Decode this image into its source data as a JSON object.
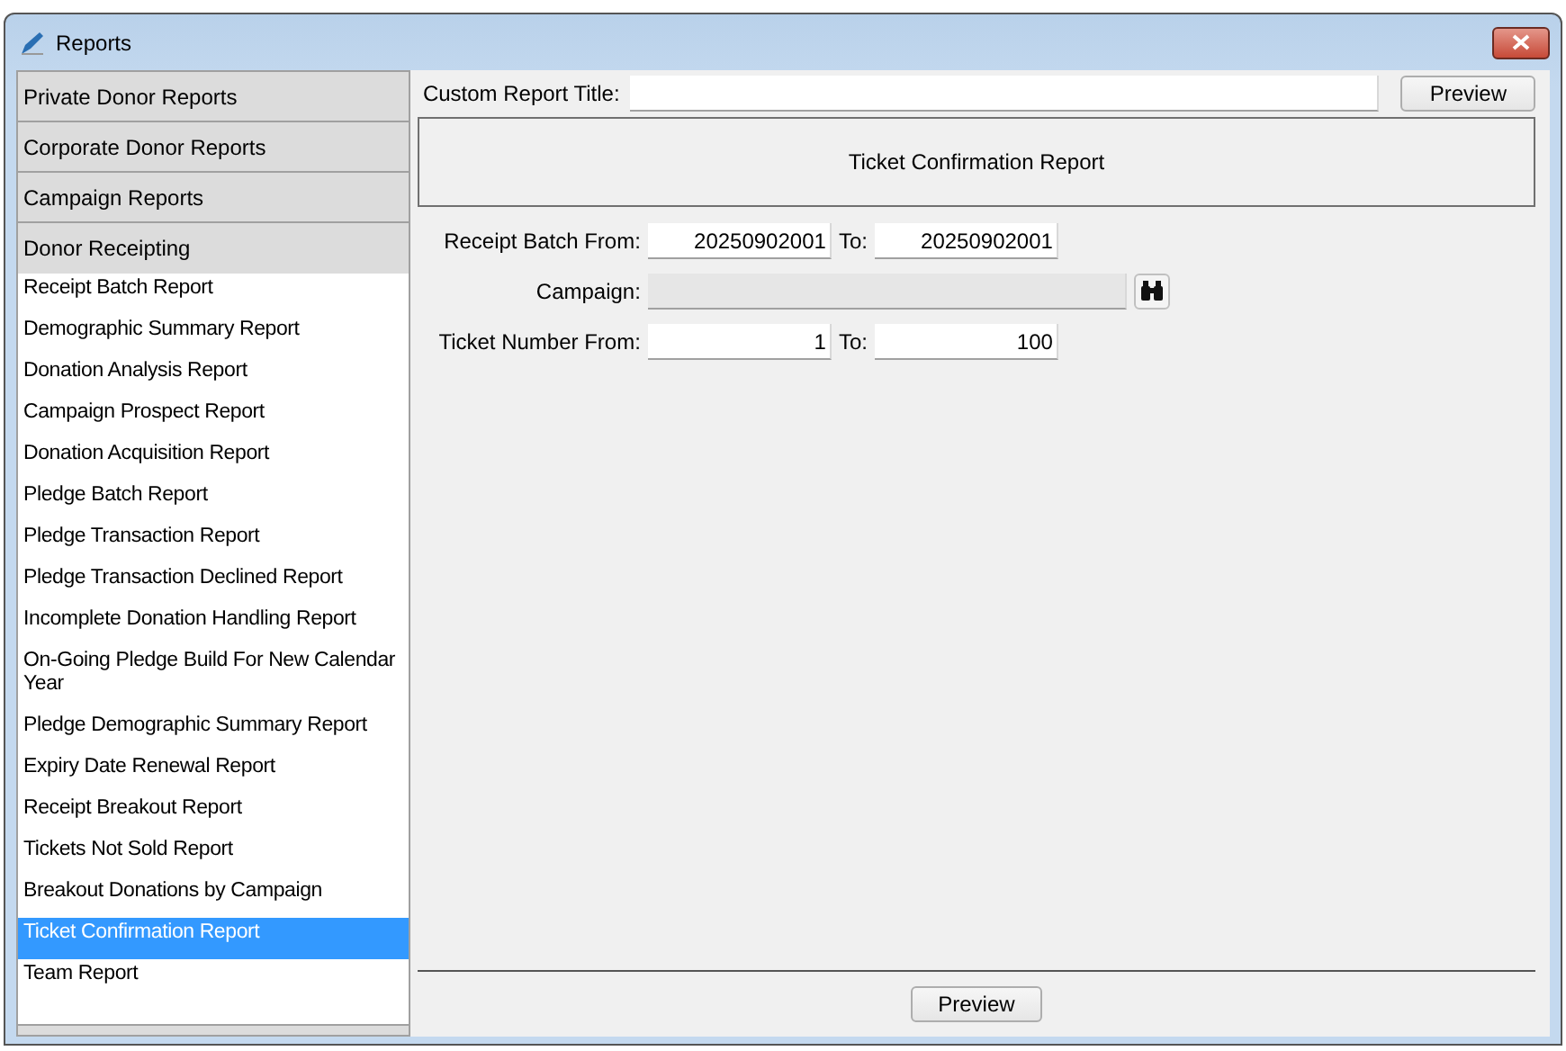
{
  "window": {
    "title": "Reports"
  },
  "sidebar": {
    "groups": [
      {
        "label": "Private Donor Reports",
        "expanded": false
      },
      {
        "label": "Corporate Donor Reports",
        "expanded": false
      },
      {
        "label": "Campaign Reports",
        "expanded": false
      },
      {
        "label": "Donor Receipting",
        "expanded": true,
        "items": [
          {
            "label": "Receipt Batch Report",
            "selected": false
          },
          {
            "label": "Demographic Summary Report",
            "selected": false
          },
          {
            "label": "Donation Analysis Report",
            "selected": false
          },
          {
            "label": "Campaign Prospect Report",
            "selected": false
          },
          {
            "label": "Donation Acquisition Report",
            "selected": false
          },
          {
            "label": "Pledge Batch Report",
            "selected": false
          },
          {
            "label": "Pledge Transaction Report",
            "selected": false
          },
          {
            "label": "Pledge Transaction Declined Report",
            "selected": false
          },
          {
            "label": "Incomplete Donation Handling Report",
            "selected": false
          },
          {
            "label": "On-Going Pledge Build For New Calendar Year",
            "selected": false
          },
          {
            "label": "Pledge Demographic Summary Report",
            "selected": false
          },
          {
            "label": "Expiry Date Renewal Report",
            "selected": false
          },
          {
            "label": "Receipt Breakout Report",
            "selected": false
          },
          {
            "label": "Tickets Not Sold Report",
            "selected": false
          },
          {
            "label": "Breakout Donations by Campaign",
            "selected": false
          },
          {
            "label": "Ticket Confirmation Report",
            "selected": true
          },
          {
            "label": "Team Report",
            "selected": false
          }
        ]
      }
    ]
  },
  "custom_title": {
    "label": "Custom Report Title:"
  },
  "preview_top": "Preview",
  "report_name": "Ticket Confirmation Report",
  "rows": [
    {
      "kind": "range",
      "label": "Receipt Batch From:",
      "from": "20250902001",
      "to_label": "To:",
      "to": "20250902001"
    },
    {
      "kind": "lookup",
      "label": "Campaign:",
      "disabled": true
    },
    {
      "kind": "range",
      "label": "Ticket Number From:",
      "from": "1",
      "to_label": "To:",
      "to": "100"
    }
  ],
  "preview_bottom": "Preview"
}
